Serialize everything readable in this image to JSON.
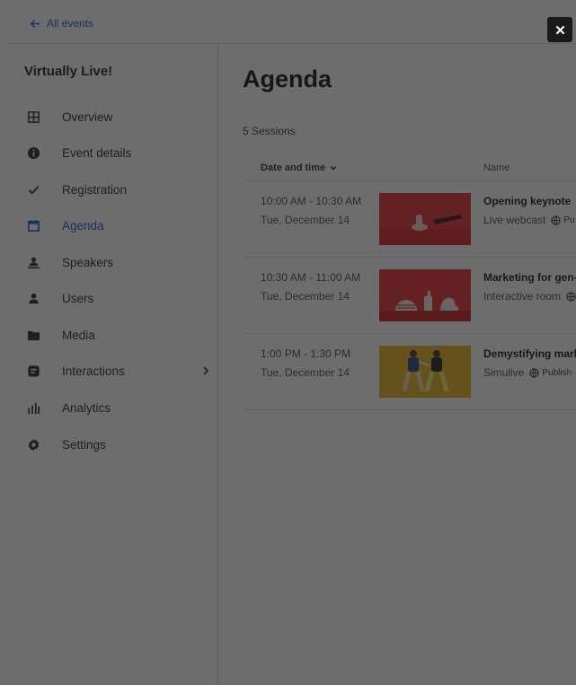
{
  "topbar": {
    "back_label": "All events"
  },
  "sidebar": {
    "title": "Virtually Live!",
    "items": [
      {
        "label": "Overview",
        "icon": "grid-icon",
        "active": false
      },
      {
        "label": "Event details",
        "icon": "info-icon",
        "active": false
      },
      {
        "label": "Registration",
        "icon": "check-icon",
        "active": false
      },
      {
        "label": "Agenda",
        "icon": "calendar-icon",
        "active": true
      },
      {
        "label": "Speakers",
        "icon": "speaker-icon",
        "active": false
      },
      {
        "label": "Users",
        "icon": "user-icon",
        "active": false
      },
      {
        "label": "Media",
        "icon": "folder-icon",
        "active": false
      },
      {
        "label": "Interactions",
        "icon": "chat-icon",
        "active": false,
        "has_submenu": true
      },
      {
        "label": "Analytics",
        "icon": "bar-chart-icon",
        "active": false
      },
      {
        "label": "Settings",
        "icon": "gear-icon",
        "active": false
      }
    ]
  },
  "main": {
    "title": "Agenda",
    "session_count": "5 Sessions",
    "columns": {
      "date": "Date and time",
      "name": "Name"
    },
    "sessions": [
      {
        "time": "10:00 AM - 10:30 AM",
        "date": "Tue, December 14",
        "name": "Opening keynote",
        "type": "Live webcast",
        "status": "Pu"
      },
      {
        "time": "10:30 AM - 11:00 AM",
        "date": "Tue, December 14",
        "name": "Marketing for gen-z",
        "type": "Interactive room",
        "status": ""
      },
      {
        "time": "1:00 PM - 1:30 PM",
        "date": "Tue, December 14",
        "name": "Demystifying marke",
        "type": "Simulive",
        "status": "Publish"
      }
    ]
  },
  "colors": {
    "accent": "#2463d8",
    "overlay": "rgba(20,20,20,0.62)",
    "thumb_red": "#e8383f",
    "thumb_yellow": "#e9b62b"
  }
}
